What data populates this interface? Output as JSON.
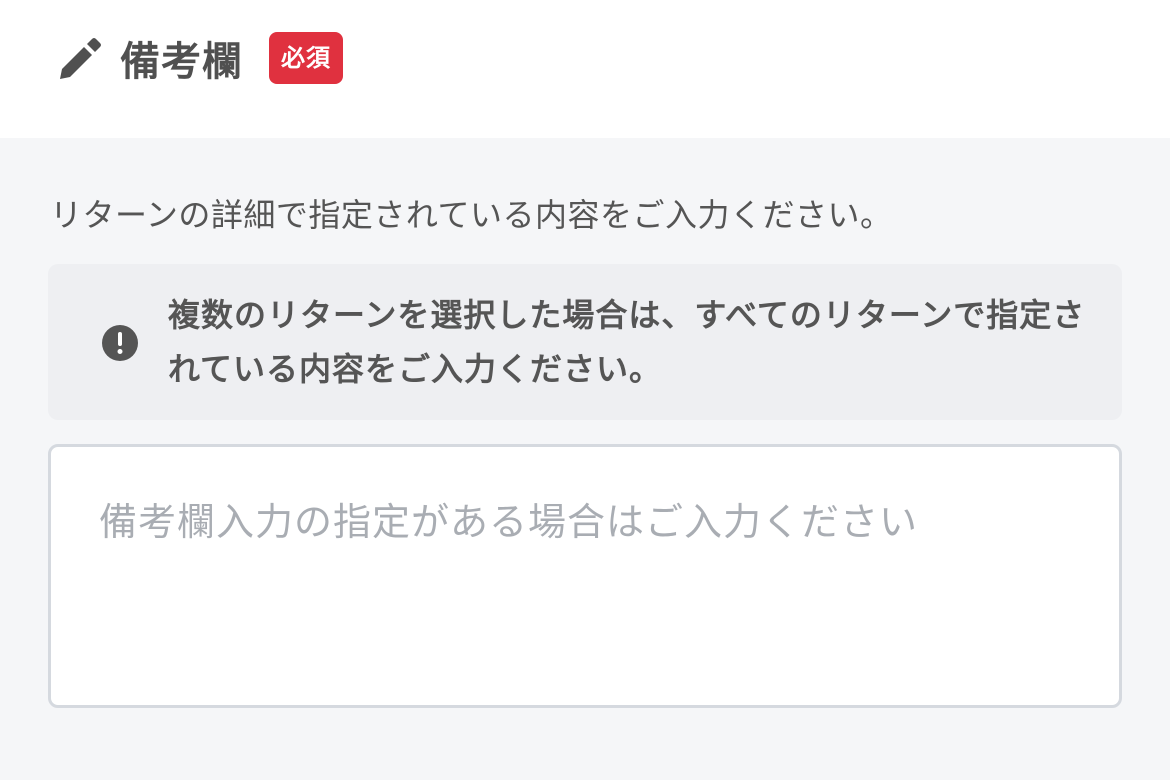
{
  "header": {
    "icon": "pencil-icon",
    "title": "備考欄",
    "required_badge": "必須",
    "badge_color": "#e0313f"
  },
  "instruction": "リターンの詳細で指定されている内容をご入力ください。",
  "notice": {
    "icon": "exclamation-circle-icon",
    "text": "複数のリターンを選択した場合は、すべてのリターンで指定されている内容をご入力ください。"
  },
  "remarks_input": {
    "placeholder": "備考欄入力の指定がある場合はご入力ください",
    "value": ""
  }
}
